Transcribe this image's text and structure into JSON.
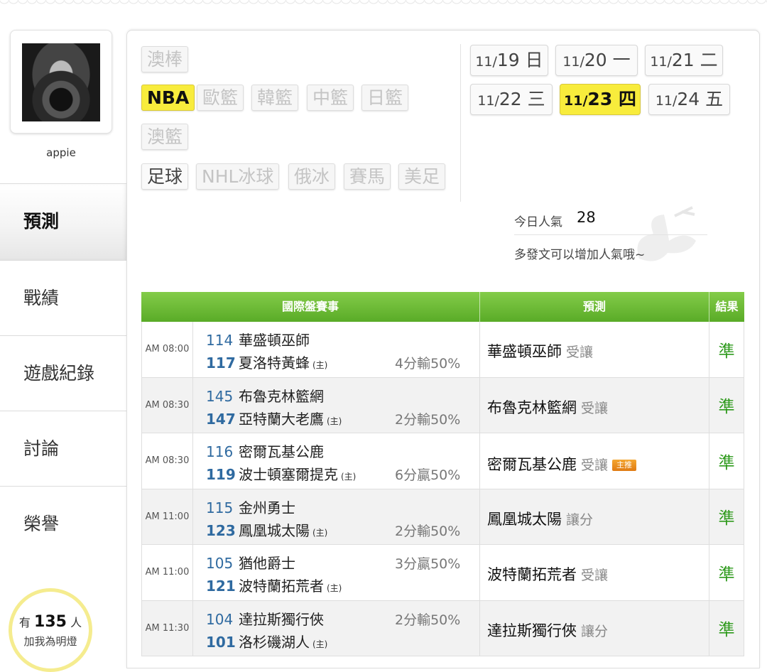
{
  "user": {
    "name": "appie"
  },
  "nav": {
    "items": [
      "預測",
      "戰績",
      "遊戲紀錄",
      "討論",
      "榮譽"
    ],
    "active": 0
  },
  "fans": {
    "prefix": "有",
    "count": "135",
    "suffix": "人",
    "label": "加我為明燈"
  },
  "sports": {
    "row1": [
      "澳棒"
    ],
    "row2": [
      "NBA",
      "歐籃",
      "韓籃",
      "中籃",
      "日籃"
    ],
    "row3": [
      "澳籃"
    ],
    "row4": [
      "足球",
      "NHL冰球",
      "俄冰",
      "賽馬",
      "美足"
    ],
    "selected": "NBA"
  },
  "dates": [
    {
      "md": "11/",
      "day": "19",
      "wd": "日"
    },
    {
      "md": "11/",
      "day": "20",
      "wd": "一"
    },
    {
      "md": "11/",
      "day": "21",
      "wd": "二"
    },
    {
      "md": "11/",
      "day": "22",
      "wd": "三"
    },
    {
      "md": "11/",
      "day": "23",
      "wd": "四"
    },
    {
      "md": "11/",
      "day": "24",
      "wd": "五"
    }
  ],
  "popularity": {
    "label": "今日人氣",
    "value": "28",
    "hint": "多發文可以增加人氣哦~"
  },
  "table": {
    "headers": {
      "event": "國際盤賽事",
      "prediction": "預測",
      "result": "結果"
    },
    "rows": [
      {
        "time": "AM 08:00",
        "away_no": "114",
        "away": "華盛頓巫師",
        "home_no": "117",
        "home": "夏洛特黃蜂",
        "host": "(主)",
        "odds": "4分輸50%",
        "odds_line": 2,
        "pick": "華盛頓巫師",
        "pick_tag": "受讓",
        "badge": "",
        "result": "準"
      },
      {
        "time": "AM 08:30",
        "away_no": "145",
        "away": "布魯克林籃網",
        "home_no": "147",
        "home": "亞特蘭大老鷹",
        "host": "(主)",
        "odds": "2分輸50%",
        "odds_line": 2,
        "pick": "布魯克林籃網",
        "pick_tag": "受讓",
        "badge": "",
        "result": "準"
      },
      {
        "time": "AM 08:30",
        "away_no": "116",
        "away": "密爾瓦基公鹿",
        "home_no": "119",
        "home": "波士頓塞爾提克",
        "host": "(主)",
        "odds": "6分贏50%",
        "odds_line": 2,
        "pick": "密爾瓦基公鹿",
        "pick_tag": "受讓",
        "badge": "主推",
        "result": "準"
      },
      {
        "time": "AM 11:00",
        "away_no": "115",
        "away": "金州勇士",
        "home_no": "123",
        "home": "鳳凰城太陽",
        "host": "(主)",
        "odds": "2分輸50%",
        "odds_line": 2,
        "pick": "鳳凰城太陽",
        "pick_tag": "讓分",
        "badge": "",
        "result": "準"
      },
      {
        "time": "AM 11:00",
        "away_no": "105",
        "away": "猶他爵士",
        "home_no": "121",
        "home": "波特蘭拓荒者",
        "host": "(主)",
        "odds": "3分贏50%",
        "odds_line": 1,
        "pick": "波特蘭拓荒者",
        "pick_tag": "受讓",
        "badge": "",
        "result": "準"
      },
      {
        "time": "AM 11:30",
        "away_no": "104",
        "away": "達拉斯獨行俠",
        "home_no": "101",
        "home": "洛杉磯湖人",
        "host": "(主)",
        "odds": "2分輸50%",
        "odds_line": 1,
        "pick": "達拉斯獨行俠",
        "pick_tag": "讓分",
        "badge": "",
        "result": "準"
      }
    ]
  }
}
